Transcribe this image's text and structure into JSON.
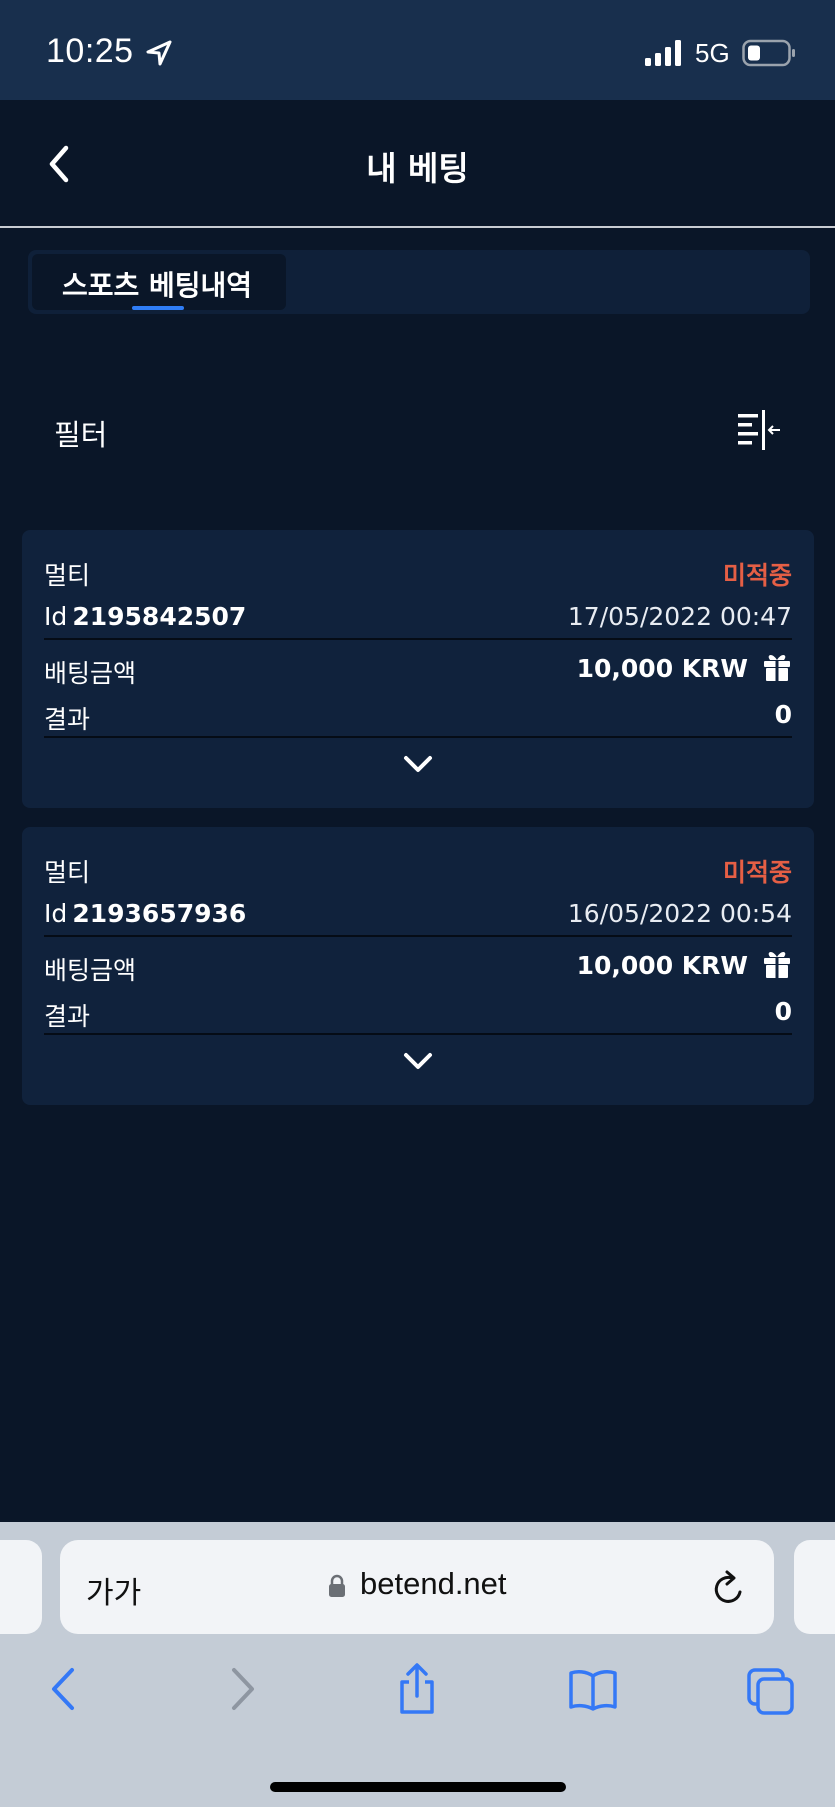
{
  "status_bar": {
    "time": "10:25",
    "network": "5G",
    "icons": [
      "location-arrow-icon",
      "signal-bars-icon",
      "battery-icon"
    ]
  },
  "header": {
    "title": "내 베팅",
    "back_icon": "chevron-left-icon"
  },
  "tabs": [
    {
      "label": "스포츠 베팅내역",
      "active": true
    }
  ],
  "filter": {
    "label": "필터",
    "icon": "filter-collapse-icon"
  },
  "bets": [
    {
      "type": "멀티",
      "status": "미적중",
      "id_prefix": "Id",
      "id": "2195842507",
      "date": "17/05/2022 00:47",
      "stake_label": "배팅금액",
      "stake": "10,000 KRW",
      "result_label": "결과",
      "result": "0"
    },
    {
      "type": "멀티",
      "status": "미적중",
      "id_prefix": "Id",
      "id": "2193657936",
      "date": "16/05/2022 00:54",
      "stake_label": "배팅금액",
      "stake": "10,000 KRW",
      "result_label": "결과",
      "result": "0"
    }
  ],
  "browser": {
    "text_size_label": "가가",
    "url": "betend.net",
    "nav_icons": [
      "back-arrow-icon",
      "forward-arrow-icon",
      "share-icon",
      "bookmarks-icon",
      "tabs-icon"
    ]
  },
  "colors": {
    "background": "#0a1628",
    "card": "#10223c",
    "status_bar": "#182f4d",
    "lost_status": "#e55f45",
    "tab_indicator": "#2f7df6",
    "browser_accent": "#3478f6"
  }
}
